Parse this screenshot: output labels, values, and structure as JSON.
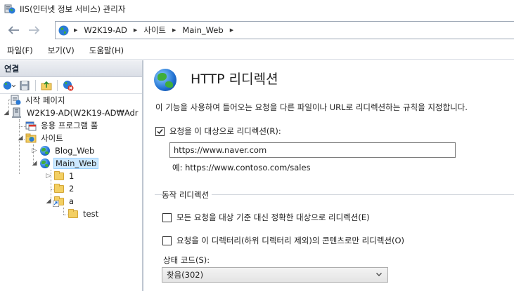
{
  "window": {
    "title": "IIS(인터넷 정보 서비스) 관리자"
  },
  "address": {
    "breadcrumbs": [
      "W2K19-AD",
      "사이트",
      "Main_Web"
    ]
  },
  "menu": [
    "파일(F)",
    "보기(V)",
    "도움말(H)"
  ],
  "connections": {
    "header": "연결",
    "tree": {
      "start_page": "시작 페이지",
      "server": "W2K19-AD(W2K19-AD₩Adr",
      "app_pools": "응용 프로그램 풀",
      "sites": "사이트",
      "blog_web": "Blog_Web",
      "main_web": "Main_Web",
      "folder_1": "1",
      "folder_2": "2",
      "folder_a": "a",
      "folder_test": "test"
    }
  },
  "feature": {
    "title": "HTTP 리디렉션",
    "description": "이 기능을 사용하여 들어오는 요청을 다른 파일이나 URL로 리디렉션하는 규칙을 지정합니다.",
    "redirect_checkbox": {
      "label": "요청을 이 대상으로 리디렉션(R):",
      "checked": true
    },
    "redirect_url": "https://www.naver.com",
    "example": "예: https://www.contoso.com/sales",
    "behavior_section": "동작 리디렉션",
    "exact_dest_checkbox": {
      "label": "모든 요청을 대상 기준 대신 정확한 대상으로 리디렉션(E)",
      "checked": false
    },
    "only_dir_checkbox": {
      "label": "요청을 이 디렉터리(하위 디렉터리 제외)의 콘텐츠로만 리디렉션(O)",
      "checked": false
    },
    "status_code_label": "상태 코드(S):",
    "status_code_value": "찾음(302)"
  }
}
